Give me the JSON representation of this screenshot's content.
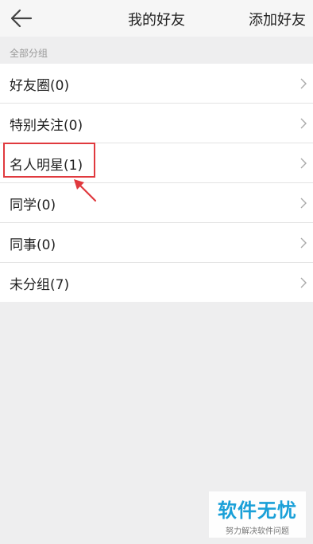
{
  "header": {
    "title": "我的好友",
    "add_friend": "添加好友"
  },
  "section": {
    "label": "全部分组"
  },
  "groups": [
    {
      "label": "好友圈(0)"
    },
    {
      "label": "特别关注(0)"
    },
    {
      "label": "名人明星(1)"
    },
    {
      "label": "同学(0)"
    },
    {
      "label": "同事(0)"
    },
    {
      "label": "未分组(7)"
    }
  ],
  "watermark": {
    "main": "软件无忧",
    "sub": "努力解决软件问题"
  },
  "colors": {
    "highlight": "#e0393e",
    "watermark": "#1aa0d8"
  }
}
